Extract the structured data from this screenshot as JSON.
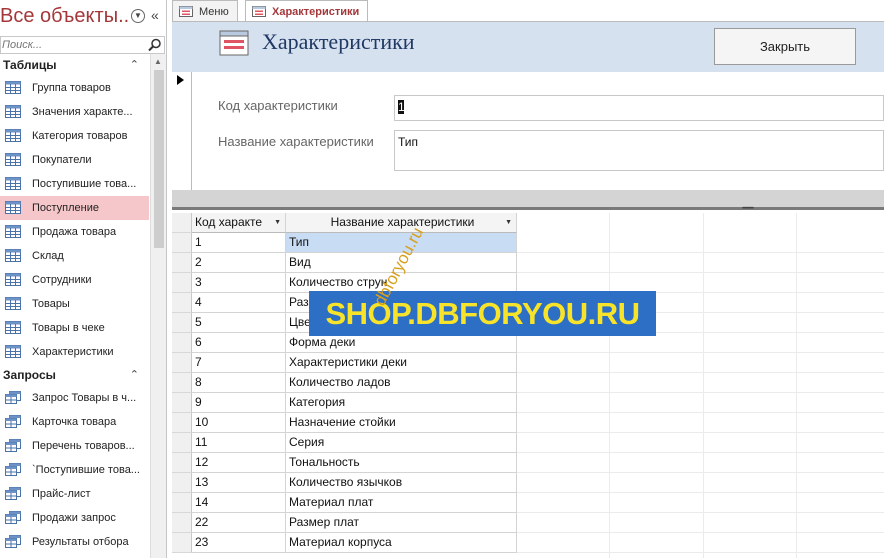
{
  "nav": {
    "title": "Все объекты...",
    "search_placeholder": "Поиск...",
    "groups": [
      {
        "label": "Таблицы",
        "items": [
          {
            "label": "Группа товаров",
            "icon": "table-icon"
          },
          {
            "label": "Значения характе...",
            "icon": "table-icon"
          },
          {
            "label": "Категория товаров",
            "icon": "table-icon"
          },
          {
            "label": "Покупатели",
            "icon": "table-icon"
          },
          {
            "label": "Поступившие това...",
            "icon": "table-icon"
          },
          {
            "label": "Поступление",
            "icon": "table-icon",
            "selected": true
          },
          {
            "label": "Продажа товара",
            "icon": "table-icon"
          },
          {
            "label": "Склад",
            "icon": "table-icon"
          },
          {
            "label": "Сотрудники",
            "icon": "table-icon"
          },
          {
            "label": "Товары",
            "icon": "table-icon"
          },
          {
            "label": "Товары в чеке",
            "icon": "table-icon"
          },
          {
            "label": "Характеристики",
            "icon": "table-icon"
          }
        ]
      },
      {
        "label": "Запросы",
        "items": [
          {
            "label": "Запрос Товары в ч...",
            "icon": "query-icon"
          },
          {
            "label": "Карточка товара",
            "icon": "query-icon"
          },
          {
            "label": "Перечень товаров...",
            "icon": "query-icon"
          },
          {
            "label": "`Поступившие това...",
            "icon": "query-icon"
          },
          {
            "label": "Прайс-лист",
            "icon": "query-icon"
          },
          {
            "label": "Продажи запрос",
            "icon": "query-icon"
          },
          {
            "label": "Результаты отбора",
            "icon": "query-icon"
          }
        ]
      }
    ]
  },
  "tabs": [
    {
      "label": "Меню",
      "active": false
    },
    {
      "label": "Характеристики",
      "active": true
    }
  ],
  "form": {
    "title": "Характеристики",
    "close_label": "Закрыть",
    "fields": {
      "code_label": "Код характеристики",
      "code_value": "1",
      "name_label": "Название характеристики",
      "name_value": "Тип"
    }
  },
  "datasheet": {
    "columns": [
      "Код характе",
      "Название характеристики"
    ],
    "rows": [
      [
        "1",
        "Тип"
      ],
      [
        "2",
        "Вид"
      ],
      [
        "3",
        "Количество струн"
      ],
      [
        "4",
        "Размер"
      ],
      [
        "5",
        "Цвет"
      ],
      [
        "6",
        "Форма деки"
      ],
      [
        "7",
        "Характеристики деки"
      ],
      [
        "8",
        "Количество ладов"
      ],
      [
        "9",
        "Категория"
      ],
      [
        "10",
        "Назначение стойки"
      ],
      [
        "11",
        "Серия"
      ],
      [
        "12",
        "Тональность"
      ],
      [
        "13",
        "Количество язычков"
      ],
      [
        "14",
        "Материал плат"
      ],
      [
        "22",
        "Размер плат"
      ],
      [
        "23",
        "Материал корпуса"
      ]
    ]
  },
  "watermark": {
    "main": "SHOP.DBFORYOU.RU",
    "diagonal": "dbforyou.ru"
  },
  "colors": {
    "nav_title": "#a4373a",
    "form_header_bg": "#d6e1ef",
    "form_title": "#1f3864",
    "selected_nav": "#f6c7ca",
    "watermark_bg": "#2d6fc4",
    "watermark_fg": "#f7e32a"
  }
}
